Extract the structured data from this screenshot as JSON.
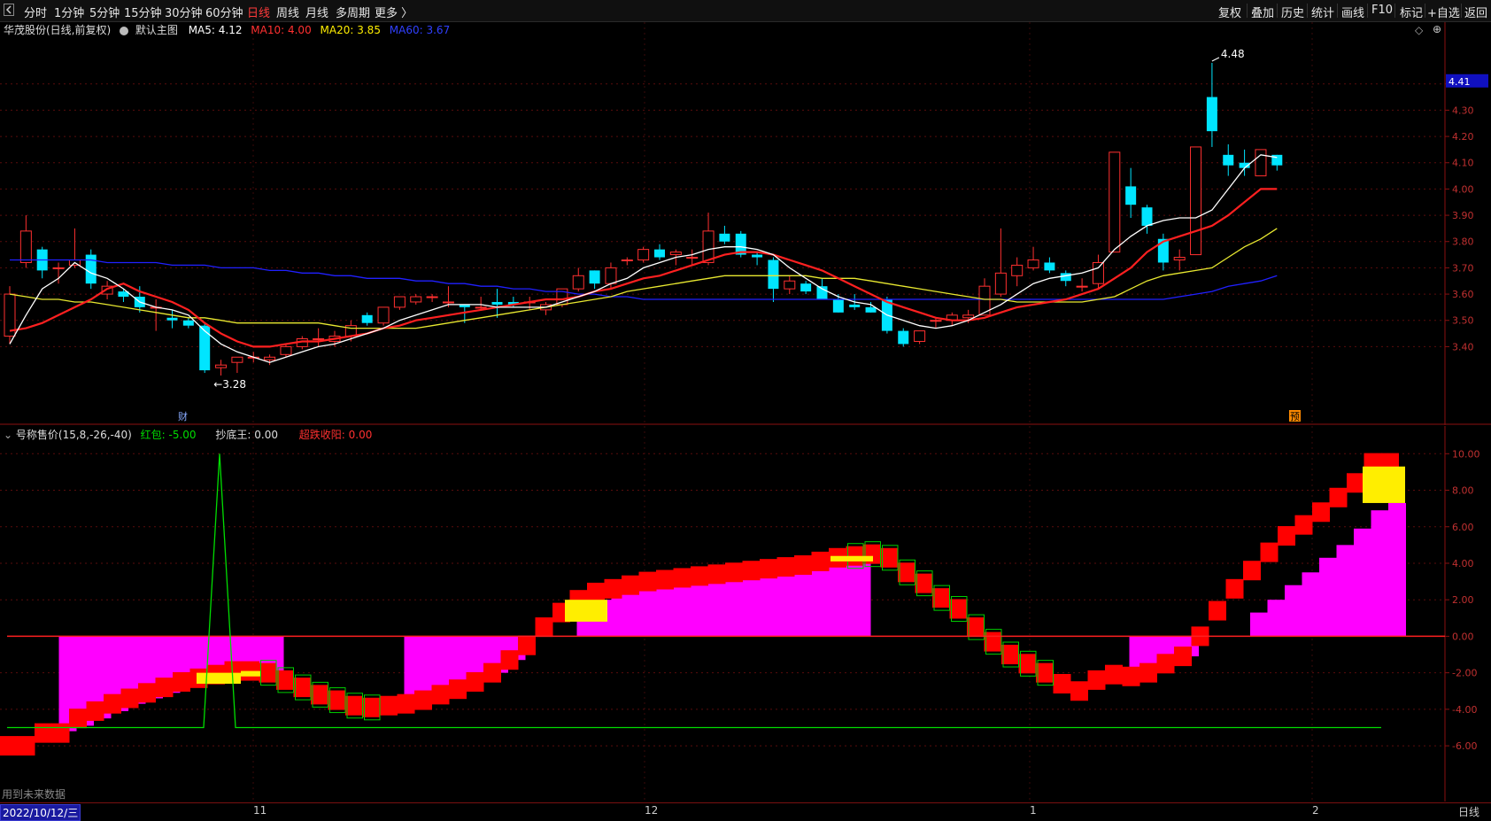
{
  "toolbar": {
    "back_icon": "chevron-left-icon",
    "periods": [
      "分时",
      "1分钟",
      "5分钟",
      "15分钟",
      "30分钟",
      "60分钟",
      "日线",
      "周线",
      "月线",
      "多周期",
      "更多 〉"
    ],
    "active_period": "日线",
    "right_buttons": [
      "复权",
      "叠加",
      "历史",
      "统计",
      "画线",
      "F10",
      "标记",
      "+自选",
      "返回"
    ]
  },
  "main_legend": {
    "title": "华茂股份(日线,前复权)",
    "template": "默认主图",
    "ma5": "MA5: 4.12",
    "ma10": "MA10: 4.00",
    "ma20": "MA20: 3.85",
    "ma60": "MA60: 3.67"
  },
  "sub_legend": {
    "name": "号称售价(15,8,-26,-40)",
    "hongbao": "红包: -5.00",
    "chaodi": "抄底王: 0.00",
    "zhuijian": "超跌收阳: 0.00"
  },
  "annotations": {
    "high_label": "4.48",
    "low_label": "←3.28",
    "cai_marker": "财",
    "yu_marker": "预",
    "current_price": "4.41",
    "future_note": "用到未来数据"
  },
  "bottom": {
    "date": "2022/10/12/三",
    "months": [
      "11",
      "12",
      "1",
      "2"
    ],
    "period": "日线"
  },
  "colors": {
    "up": "#ff3030",
    "down": "#00e5ff",
    "ma5": "#ffffff",
    "ma10": "#ff2020",
    "ma20": "#e8e830",
    "ma60": "#2020ff",
    "magenta": "#ff00ff",
    "yellow": "#ffee00",
    "green": "#00cc00"
  },
  "chart_data": [
    {
      "type": "candlestick",
      "title": "华茂股份(日线,前复权)",
      "ylim": [
        3.28,
        4.48
      ],
      "yticks": [
        3.4,
        3.5,
        3.6,
        3.7,
        3.8,
        3.9,
        4.0,
        4.1,
        4.2,
        4.3,
        4.4
      ],
      "ohlc": [
        [
          3.44,
          3.63,
          3.41,
          3.6
        ],
        [
          3.72,
          3.9,
          3.7,
          3.84
        ],
        [
          3.77,
          3.78,
          3.66,
          3.69
        ],
        [
          3.7,
          3.72,
          3.64,
          3.7
        ],
        [
          3.71,
          3.85,
          3.7,
          3.73
        ],
        [
          3.75,
          3.77,
          3.62,
          3.64
        ],
        [
          3.6,
          3.65,
          3.58,
          3.63
        ],
        [
          3.61,
          3.62,
          3.57,
          3.59
        ],
        [
          3.59,
          3.63,
          3.53,
          3.55
        ],
        [
          3.55,
          3.58,
          3.46,
          3.55
        ],
        [
          3.51,
          3.54,
          3.47,
          3.5
        ],
        [
          3.5,
          3.51,
          3.47,
          3.48
        ],
        [
          3.48,
          3.49,
          3.3,
          3.31
        ],
        [
          3.32,
          3.35,
          3.29,
          3.33
        ],
        [
          3.34,
          3.36,
          3.3,
          3.36
        ],
        [
          3.36,
          3.38,
          3.34,
          3.36
        ],
        [
          3.35,
          3.37,
          3.33,
          3.36
        ],
        [
          3.37,
          3.41,
          3.36,
          3.4
        ],
        [
          3.4,
          3.44,
          3.39,
          3.43
        ],
        [
          3.43,
          3.47,
          3.4,
          3.43
        ],
        [
          3.42,
          3.46,
          3.4,
          3.44
        ],
        [
          3.44,
          3.5,
          3.42,
          3.48
        ],
        [
          3.52,
          3.53,
          3.48,
          3.49
        ],
        [
          3.49,
          3.55,
          3.48,
          3.55
        ],
        [
          3.55,
          3.59,
          3.54,
          3.59
        ],
        [
          3.57,
          3.6,
          3.56,
          3.59
        ],
        [
          3.59,
          3.6,
          3.57,
          3.59
        ],
        [
          3.57,
          3.63,
          3.55,
          3.57
        ],
        [
          3.56,
          3.56,
          3.49,
          3.55
        ],
        [
          3.55,
          3.59,
          3.54,
          3.55
        ],
        [
          3.57,
          3.62,
          3.51,
          3.56
        ],
        [
          3.57,
          3.59,
          3.55,
          3.56
        ],
        [
          3.57,
          3.59,
          3.54,
          3.57
        ],
        [
          3.54,
          3.57,
          3.52,
          3.56
        ],
        [
          3.56,
          3.62,
          3.55,
          3.62
        ],
        [
          3.62,
          3.7,
          3.61,
          3.67
        ],
        [
          3.69,
          3.69,
          3.62,
          3.64
        ],
        [
          3.64,
          3.72,
          3.62,
          3.7
        ],
        [
          3.73,
          3.74,
          3.71,
          3.73
        ],
        [
          3.73,
          3.78,
          3.72,
          3.77
        ],
        [
          3.77,
          3.79,
          3.73,
          3.74
        ],
        [
          3.75,
          3.77,
          3.71,
          3.76
        ],
        [
          3.74,
          3.77,
          3.71,
          3.74
        ],
        [
          3.72,
          3.91,
          3.71,
          3.84
        ],
        [
          3.83,
          3.86,
          3.79,
          3.8
        ],
        [
          3.83,
          3.84,
          3.74,
          3.75
        ],
        [
          3.75,
          3.76,
          3.71,
          3.74
        ],
        [
          3.73,
          3.74,
          3.57,
          3.62
        ],
        [
          3.62,
          3.67,
          3.6,
          3.65
        ],
        [
          3.64,
          3.65,
          3.6,
          3.61
        ],
        [
          3.63,
          3.66,
          3.58,
          3.58
        ],
        [
          3.58,
          3.6,
          3.53,
          3.53
        ],
        [
          3.56,
          3.6,
          3.54,
          3.55
        ],
        [
          3.55,
          3.57,
          3.53,
          3.53
        ],
        [
          3.58,
          3.59,
          3.45,
          3.46
        ],
        [
          3.46,
          3.47,
          3.4,
          3.41
        ],
        [
          3.42,
          3.46,
          3.41,
          3.46
        ],
        [
          3.5,
          3.51,
          3.47,
          3.5
        ],
        [
          3.5,
          3.53,
          3.48,
          3.52
        ],
        [
          3.51,
          3.54,
          3.49,
          3.52
        ],
        [
          3.52,
          3.66,
          3.52,
          3.63
        ],
        [
          3.6,
          3.85,
          3.59,
          3.68
        ],
        [
          3.67,
          3.74,
          3.63,
          3.71
        ],
        [
          3.7,
          3.78,
          3.69,
          3.73
        ],
        [
          3.72,
          3.74,
          3.68,
          3.69
        ],
        [
          3.68,
          3.69,
          3.63,
          3.65
        ],
        [
          3.63,
          3.66,
          3.61,
          3.63
        ],
        [
          3.64,
          3.75,
          3.62,
          3.72
        ],
        [
          3.76,
          4.14,
          3.76,
          4.14
        ],
        [
          4.01,
          4.08,
          3.89,
          3.94
        ],
        [
          3.93,
          3.94,
          3.83,
          3.86
        ],
        [
          3.81,
          3.83,
          3.69,
          3.72
        ],
        [
          3.73,
          3.77,
          3.69,
          3.74
        ],
        [
          3.75,
          4.16,
          3.75,
          4.16
        ],
        [
          4.35,
          4.48,
          4.16,
          4.22
        ],
        [
          4.13,
          4.17,
          4.05,
          4.09
        ],
        [
          4.1,
          4.15,
          4.05,
          4.08
        ],
        [
          4.05,
          4.15,
          4.05,
          4.15
        ],
        [
          4.13,
          4.13,
          4.07,
          4.09
        ]
      ],
      "ma5": [
        3.41,
        3.52,
        3.62,
        3.66,
        3.72,
        3.68,
        3.66,
        3.62,
        3.57,
        3.55,
        3.54,
        3.52,
        3.46,
        3.41,
        3.38,
        3.36,
        3.34,
        3.36,
        3.38,
        3.4,
        3.41,
        3.43,
        3.45,
        3.47,
        3.5,
        3.52,
        3.54,
        3.56,
        3.56,
        3.56,
        3.55,
        3.55,
        3.55,
        3.55,
        3.57,
        3.59,
        3.61,
        3.64,
        3.66,
        3.7,
        3.72,
        3.74,
        3.75,
        3.77,
        3.78,
        3.78,
        3.77,
        3.75,
        3.7,
        3.66,
        3.62,
        3.59,
        3.57,
        3.56,
        3.52,
        3.5,
        3.48,
        3.47,
        3.48,
        3.5,
        3.53,
        3.56,
        3.6,
        3.64,
        3.66,
        3.67,
        3.68,
        3.7,
        3.77,
        3.82,
        3.86,
        3.88,
        3.89,
        3.89,
        3.92,
        4.0,
        4.08,
        4.13,
        4.12
      ],
      "ma10": [
        3.46,
        3.47,
        3.49,
        3.52,
        3.55,
        3.58,
        3.62,
        3.64,
        3.61,
        3.59,
        3.57,
        3.54,
        3.49,
        3.45,
        3.42,
        3.4,
        3.4,
        3.41,
        3.42,
        3.42,
        3.43,
        3.44,
        3.45,
        3.47,
        3.48,
        3.5,
        3.51,
        3.52,
        3.53,
        3.54,
        3.55,
        3.56,
        3.57,
        3.58,
        3.58,
        3.59,
        3.61,
        3.62,
        3.64,
        3.66,
        3.67,
        3.69,
        3.71,
        3.73,
        3.75,
        3.76,
        3.76,
        3.75,
        3.73,
        3.71,
        3.69,
        3.66,
        3.63,
        3.6,
        3.57,
        3.55,
        3.53,
        3.51,
        3.5,
        3.5,
        3.51,
        3.53,
        3.55,
        3.56,
        3.57,
        3.58,
        3.6,
        3.62,
        3.66,
        3.7,
        3.76,
        3.8,
        3.82,
        3.84,
        3.86,
        3.9,
        3.95,
        4.0,
        4.0
      ],
      "ma20": [
        3.6,
        3.59,
        3.58,
        3.58,
        3.57,
        3.57,
        3.56,
        3.55,
        3.54,
        3.53,
        3.52,
        3.51,
        3.51,
        3.5,
        3.49,
        3.49,
        3.49,
        3.49,
        3.49,
        3.49,
        3.48,
        3.47,
        3.47,
        3.47,
        3.47,
        3.47,
        3.48,
        3.49,
        3.5,
        3.51,
        3.52,
        3.53,
        3.54,
        3.55,
        3.56,
        3.57,
        3.58,
        3.59,
        3.61,
        3.62,
        3.63,
        3.64,
        3.65,
        3.66,
        3.67,
        3.67,
        3.67,
        3.67,
        3.67,
        3.67,
        3.66,
        3.66,
        3.66,
        3.65,
        3.64,
        3.63,
        3.62,
        3.61,
        3.6,
        3.59,
        3.58,
        3.58,
        3.57,
        3.57,
        3.57,
        3.57,
        3.57,
        3.58,
        3.59,
        3.62,
        3.65,
        3.67,
        3.68,
        3.69,
        3.7,
        3.74,
        3.78,
        3.81,
        3.85
      ],
      "ma60": [
        3.73,
        3.73,
        3.73,
        3.73,
        3.73,
        3.73,
        3.72,
        3.72,
        3.72,
        3.72,
        3.71,
        3.71,
        3.71,
        3.7,
        3.7,
        3.7,
        3.69,
        3.69,
        3.68,
        3.68,
        3.67,
        3.67,
        3.66,
        3.66,
        3.66,
        3.65,
        3.65,
        3.64,
        3.64,
        3.63,
        3.63,
        3.62,
        3.62,
        3.61,
        3.61,
        3.6,
        3.6,
        3.59,
        3.59,
        3.58,
        3.58,
        3.58,
        3.58,
        3.58,
        3.58,
        3.58,
        3.58,
        3.58,
        3.58,
        3.58,
        3.58,
        3.58,
        3.58,
        3.58,
        3.58,
        3.58,
        3.58,
        3.58,
        3.58,
        3.58,
        3.58,
        3.58,
        3.58,
        3.58,
        3.58,
        3.58,
        3.58,
        3.58,
        3.58,
        3.58,
        3.58,
        3.58,
        3.59,
        3.6,
        3.61,
        3.63,
        3.64,
        3.65,
        3.67
      ]
    },
    {
      "type": "bar",
      "title": "号称售价(15,8,-26,-40)",
      "ylim": [
        -7.5,
        10.5
      ],
      "yticks": [
        -6.0,
        -4.0,
        -2.0,
        0.0,
        2.0,
        4.0,
        6.0,
        8.0,
        10.0
      ],
      "red_steps": [
        -6.0,
        -6.0,
        -5.3,
        -5.3,
        -4.5,
        -4.1,
        -3.7,
        -3.4,
        -3.1,
        -2.8,
        -2.5,
        -2.3,
        -2.1,
        -1.9,
        -1.9,
        -2.0,
        -2.4,
        -2.8,
        -3.2,
        -3.5,
        -3.8,
        -3.9,
        -3.8,
        -3.7,
        -3.5,
        -3.2,
        -2.9,
        -2.5,
        -2.0,
        -1.3,
        -0.5,
        0.5,
        1.3,
        2.0,
        2.4,
        2.6,
        2.8,
        3.0,
        3.1,
        3.2,
        3.3,
        3.4,
        3.5,
        3.6,
        3.7,
        3.8,
        3.9,
        4.1,
        4.3,
        4.4,
        4.5,
        4.3,
        3.5,
        2.9,
        2.1,
        1.5,
        0.5,
        -0.3,
        -1.0,
        -1.5,
        -2.0,
        -2.6,
        -3.0,
        -2.4,
        -2.1,
        -2.2,
        -2.0,
        -1.5,
        -1.1,
        0.0,
        1.4,
        2.6,
        3.6,
        4.6,
        5.5,
        6.1,
        6.8,
        7.6,
        8.4,
        9.5,
        9.5
      ],
      "magenta_steps": [
        0,
        0,
        0,
        -5.2,
        -4.9,
        -4.5,
        -4.1,
        -3.7,
        -3.4,
        -3.1,
        -2.8,
        -2.5,
        -2.3,
        -2.1,
        -2.0,
        -2.0,
        0,
        0,
        0,
        0,
        0,
        0,
        0,
        -3.7,
        -3.5,
        -3.2,
        -2.9,
        -2.5,
        -2.0,
        -1.3,
        0,
        0,
        0,
        1.0,
        2.0,
        2.4,
        2.6,
        2.8,
        3.0,
        3.1,
        3.2,
        3.3,
        3.4,
        3.5,
        3.6,
        3.7,
        3.8,
        3.9,
        4.1,
        4.3,
        0,
        0,
        0,
        0,
        0,
        0,
        0,
        0,
        0,
        0,
        0,
        0,
        0,
        0,
        0,
        -2.0,
        -1.8,
        -1.5,
        -1.1,
        0,
        0,
        0,
        1.3,
        2.0,
        2.8,
        3.5,
        4.3,
        5.0,
        5.9,
        6.9,
        7.3
      ],
      "green_line": {
        "base": -5.0,
        "spike_value": 10.0
      },
      "yellow_blocks": [
        [
          -2.0,
          -2.6
        ],
        [
          -1.9,
          -2.2
        ],
        [
          2.0,
          0.8
        ],
        [
          4.4,
          4.1
        ],
        [
          9.3,
          7.3
        ]
      ]
    }
  ]
}
